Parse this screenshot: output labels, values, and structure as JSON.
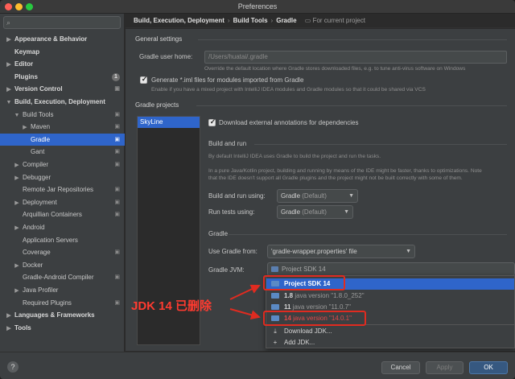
{
  "window": {
    "title": "Preferences"
  },
  "breadcrumb": {
    "items": [
      "Build, Execution, Deployment",
      "Build Tools",
      "Gradle"
    ],
    "scope": "For current project"
  },
  "sidebar": {
    "items": [
      {
        "label": "Appearance & Behavior",
        "arrow": "▶",
        "bold": true
      },
      {
        "label": "Keymap",
        "arrow": "",
        "bold": true
      },
      {
        "label": "Editor",
        "arrow": "▶",
        "bold": true
      },
      {
        "label": "Plugins",
        "arrow": "",
        "bold": true,
        "badge": "1"
      },
      {
        "label": "Version Control",
        "arrow": "▶",
        "bold": true,
        "cfg": true
      },
      {
        "label": "Build, Execution, Deployment",
        "arrow": "▼",
        "bold": true
      },
      {
        "label": "Build Tools",
        "arrow": "▼",
        "cfg": true,
        "indent": 1
      },
      {
        "label": "Maven",
        "arrow": "▶",
        "cfg": true,
        "indent": 2
      },
      {
        "label": "Gradle",
        "arrow": "",
        "cfg": true,
        "indent": 2,
        "selected": true
      },
      {
        "label": "Gant",
        "arrow": "",
        "cfg": true,
        "indent": 2
      },
      {
        "label": "Compiler",
        "arrow": "▶",
        "cfg": true,
        "indent": 1
      },
      {
        "label": "Debugger",
        "arrow": "▶",
        "indent": 1
      },
      {
        "label": "Remote Jar Repositories",
        "arrow": "",
        "cfg": true,
        "indent": 1
      },
      {
        "label": "Deployment",
        "arrow": "▶",
        "cfg": true,
        "indent": 1
      },
      {
        "label": "Arquillian Containers",
        "arrow": "",
        "cfg": true,
        "indent": 1
      },
      {
        "label": "Android",
        "arrow": "▶",
        "indent": 1
      },
      {
        "label": "Application Servers",
        "arrow": "",
        "indent": 1
      },
      {
        "label": "Coverage",
        "arrow": "",
        "cfg": true,
        "indent": 1
      },
      {
        "label": "Docker",
        "arrow": "▶",
        "indent": 1
      },
      {
        "label": "Gradle-Android Compiler",
        "arrow": "",
        "cfg": true,
        "indent": 1
      },
      {
        "label": "Java Profiler",
        "arrow": "▶",
        "indent": 1
      },
      {
        "label": "Required Plugins",
        "arrow": "",
        "cfg": true,
        "indent": 1
      },
      {
        "label": "Languages & Frameworks",
        "arrow": "▶",
        "bold": true
      },
      {
        "label": "Tools",
        "arrow": "▶",
        "bold": true
      }
    ]
  },
  "general": {
    "section": "General settings",
    "user_home_label": "Gradle user home:",
    "user_home_value": "/Users/huatai/.gradle",
    "user_home_hint": "Override the default location where Gradle stores downloaded files, e.g. to tune anti-virus software on Windows",
    "iml_label": "Generate *.iml files for modules imported from Gradle",
    "iml_hint": "Enable if you have a mixed project with IntelliJ IDEA modules and Gradle modules so that it could be shared via VCS"
  },
  "projects": {
    "section": "Gradle projects",
    "list": [
      "SkyLine"
    ],
    "download_label": "Download external annotations for dependencies"
  },
  "build_run": {
    "section": "Build and run",
    "hint1": "By default IntelliJ IDEA uses Gradle to build the project and run the tasks.",
    "hint2": "In a pure Java/Kotlin project, building and running by means of the IDE might be faster, thanks to optimizations. Note",
    "hint3": "that the IDE doesn't support all Gradle plugins and the project might not be built correctly with some of them.",
    "build_label": "Build and run using:",
    "build_value": "Gradle",
    "build_suffix": "(Default)",
    "tests_label": "Run tests using:",
    "tests_value": "Gradle",
    "tests_suffix": "(Default)"
  },
  "gradle": {
    "section": "Gradle",
    "use_from_label": "Use Gradle from:",
    "use_from_value": "'gradle-wrapper.properties' file",
    "jvm_label": "Gradle JVM:",
    "jvm_value": "Project SDK 14"
  },
  "jvm_popup": {
    "items": [
      {
        "name": "Project SDK 14",
        "ver": ""
      },
      {
        "name": "1.8",
        "ver": "java version \"1.8.0_252\""
      },
      {
        "name": "11",
        "ver": "java version \"11.0.7\""
      },
      {
        "name": "14",
        "ver": "java version \"14.0.1\""
      }
    ],
    "download": "Download JDK...",
    "add": "Add JDK..."
  },
  "annotation": {
    "text": "JDK 14 已删除"
  },
  "buttons": {
    "help": "?",
    "cancel": "Cancel",
    "apply": "Apply",
    "ok": "OK"
  },
  "colors": {
    "selection": "#2f65ca",
    "annotation": "#e02b20",
    "primary_button": "#365880"
  }
}
